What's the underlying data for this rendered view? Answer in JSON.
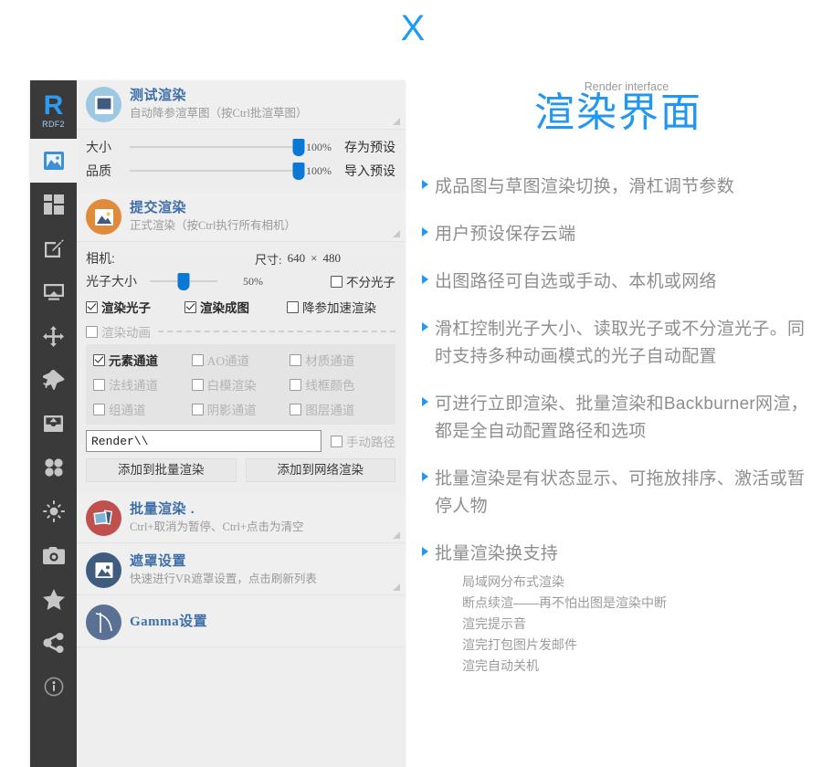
{
  "page": {
    "close_label": "X",
    "accent": "#2196f3",
    "title_color": "#2196f3"
  },
  "app": {
    "rail": {
      "logo_letter": "R",
      "logo_sub": "RDF2",
      "items": [
        {
          "icon": "image-icon",
          "active": true
        },
        {
          "icon": "grid-blocks-icon",
          "active": false
        },
        {
          "icon": "edit-square-icon",
          "active": false
        },
        {
          "icon": "monitor-icon",
          "active": false
        },
        {
          "icon": "move-arrows-icon",
          "active": false
        },
        {
          "icon": "airplane-icon",
          "active": false
        },
        {
          "icon": "inbox-tray-icon",
          "active": false
        },
        {
          "icon": "four-dots-icon",
          "active": false
        },
        {
          "icon": "sun-brightness-icon",
          "active": false
        },
        {
          "icon": "camera-icon",
          "active": false
        },
        {
          "icon": "star-icon",
          "active": false
        },
        {
          "icon": "share-nodes-icon",
          "active": false
        },
        {
          "icon": "info-circle-icon",
          "active": false
        }
      ]
    },
    "section_test": {
      "title": "测试渲染",
      "desc": "自动降参渲草图（按Ctrl批渲草图）",
      "icon": "picture-frame-icon",
      "icon_color": "#7cb4d8",
      "sliders": [
        {
          "label": "大小",
          "value": "100%",
          "percent": 100,
          "action": "存为预设"
        },
        {
          "label": "品质",
          "value": "100%",
          "percent": 100,
          "action": "导入预设"
        }
      ]
    },
    "section_submit": {
      "title": "提交渲染",
      "desc": "正式渲染（按Ctrl执行所有相机）",
      "icon": "landscape-photo-icon",
      "icon_color": "#e08a3c",
      "camera_label": "相机:",
      "size_label": "尺寸:",
      "size_w": "640",
      "size_x": "×",
      "size_h": "480",
      "photon": {
        "label": "光子大小",
        "value": "50%",
        "percent": 50,
        "checkbox": {
          "label": "不分光子",
          "checked": false
        }
      },
      "options": [
        {
          "label": "渲染光子",
          "checked": true
        },
        {
          "label": "渲染成图",
          "checked": true
        },
        {
          "label": "降参加速渲染",
          "checked": false
        }
      ],
      "anim": {
        "label": "渲染动画",
        "checked": false
      },
      "channels": [
        {
          "label": "元素通道",
          "checked": true
        },
        {
          "label": "AO通道",
          "checked": false
        },
        {
          "label": "材质通道",
          "checked": false
        },
        {
          "label": "法线通道",
          "checked": false
        },
        {
          "label": "白模渲染",
          "checked": false
        },
        {
          "label": "线框颜色",
          "checked": false
        },
        {
          "label": "组通道",
          "checked": false
        },
        {
          "label": "阴影通道",
          "checked": false
        },
        {
          "label": "图层通道",
          "checked": false
        }
      ],
      "path_value": "Render\\\\",
      "path_placeholder": "Render\\\\",
      "manual_path": {
        "label": "手动路径",
        "checked": false
      },
      "buttons": [
        "添加到批量渲染",
        "添加到网络渲染"
      ]
    },
    "section_batch": {
      "title": "批量渲染 .",
      "desc": "Ctrl+取消为暂停、Ctrl+点击为清空",
      "icon": "photo-stack-icon",
      "icon_color": "#c0504d"
    },
    "section_mask": {
      "title": "遮罩设置",
      "desc": "快速进行VR遮罩设置，点击刷新列表",
      "icon": "mask-photo-icon",
      "icon_color": "#3f5b7d"
    },
    "section_gamma": {
      "title": "Gamma设置",
      "desc": "",
      "icon": "gamma-icon",
      "icon_color": "#5b7194"
    }
  },
  "right": {
    "kicker": "Render interface",
    "title": "渲染界面",
    "bullets": [
      {
        "text": "成品图与草图渲染切换，滑杠调节参数"
      },
      {
        "text": "用户预设保存云端"
      },
      {
        "text": "出图路径可自选或手动、本机或网络"
      },
      {
        "text": "滑杠控制光子大小、读取光子或不分渲光子。同时支持多种动画模式的光子自动配置"
      },
      {
        "text": "可进行立即渲染、批量渲染和Backburner网渲，都是全自动配置路径和选项"
      },
      {
        "text": "批量渲染是有状态显示、可拖放排序、激活或暂停人物"
      },
      {
        "text": "批量渲染换支持",
        "sub": [
          "局域网分布式渲染",
          "断点续渲——再不怕出图是渲染中断",
          "渲完提示音",
          "渲完打包图片发邮件",
          "渲完自动关机"
        ]
      }
    ]
  }
}
